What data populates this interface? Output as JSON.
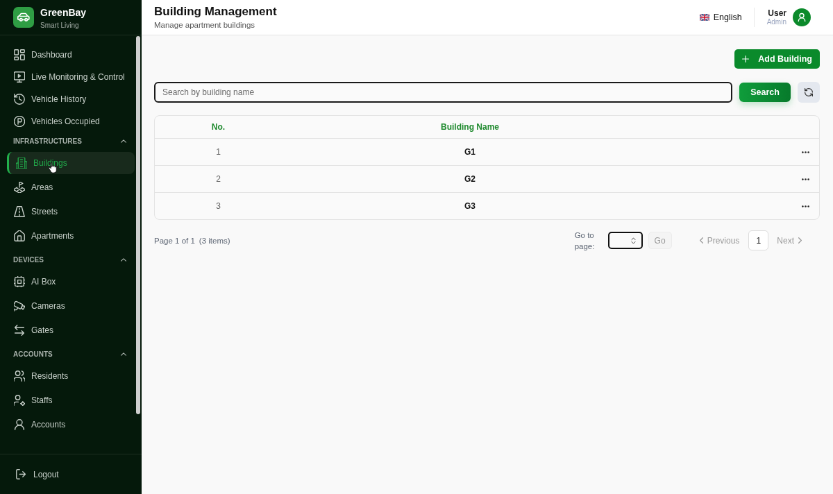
{
  "sidebar": {
    "brand": {
      "name": "GreenBay",
      "tagline": "Smart Living"
    },
    "nav": [
      {
        "label": "Dashboard",
        "selected": false
      },
      {
        "label": "Live Monitoring & Control",
        "selected": false
      },
      {
        "label": "Vehicle History",
        "selected": false
      },
      {
        "label": "Vehicles Occupied",
        "selected": false
      }
    ],
    "sections": [
      {
        "title": "INFRASTRUCTURES",
        "expanded": true,
        "items": [
          {
            "label": "Buildings",
            "selected": true
          },
          {
            "label": "Areas",
            "selected": false
          },
          {
            "label": "Streets",
            "selected": false
          },
          {
            "label": "Apartments",
            "selected": false
          }
        ]
      },
      {
        "title": "DEVICES",
        "expanded": true,
        "items": [
          {
            "label": "AI Box",
            "selected": false
          },
          {
            "label": "Cameras",
            "selected": false
          },
          {
            "label": "Gates",
            "selected": false
          }
        ]
      },
      {
        "title": "ACCOUNTS",
        "expanded": true,
        "items": [
          {
            "label": "Residents",
            "selected": false
          },
          {
            "label": "Staffs",
            "selected": false
          },
          {
            "label": "Accounts",
            "selected": false
          }
        ]
      }
    ],
    "logout": "Logout"
  },
  "header": {
    "title": "Building Management",
    "subtitle": "Manage apartment buildings",
    "language": "English",
    "user": {
      "name": "User",
      "role": "Admin"
    }
  },
  "actions": {
    "add_button": "Add Building"
  },
  "search": {
    "placeholder": "Search by building name",
    "button": "Search"
  },
  "table": {
    "columns": [
      "No.",
      "Building Name"
    ],
    "rows": [
      {
        "cells": [
          "1",
          "G1"
        ]
      },
      {
        "cells": [
          "2",
          "G2"
        ]
      },
      {
        "cells": [
          "3",
          "G3"
        ]
      }
    ]
  },
  "pagination": {
    "page_info": "Page 1 of 1",
    "item_count": "(3 items)",
    "goto_label": "Go to page:",
    "go_button": {
      "label": "Go",
      "disabled": true
    },
    "previous": {
      "label": "Previous",
      "disabled": true
    },
    "pages": [
      {
        "label": "1",
        "selected": true
      }
    ],
    "next": {
      "label": "Next",
      "disabled": true
    }
  }
}
